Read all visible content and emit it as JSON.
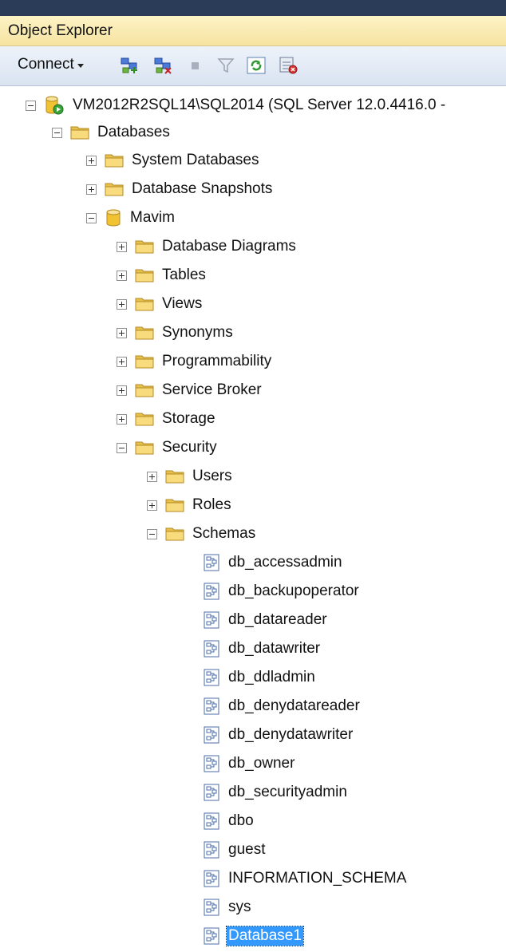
{
  "panel": {
    "title": "Object Explorer"
  },
  "toolbar": {
    "connect_label": "Connect",
    "icons": [
      "connect-object-explorer-icon",
      "disconnect-icon",
      "stop-icon",
      "filter-icon",
      "refresh-icon",
      "activity-monitor-icon"
    ]
  },
  "tree": {
    "server": "VM2012R2SQL14\\SQL2014 (SQL Server 12.0.4416.0 -",
    "databases": "Databases",
    "system_databases": "System Databases",
    "database_snapshots": "Database Snapshots",
    "mavim": "Mavim",
    "database_diagrams": "Database Diagrams",
    "tables": "Tables",
    "views": "Views",
    "synonyms": "Synonyms",
    "programmability": "Programmability",
    "service_broker": "Service Broker",
    "storage": "Storage",
    "security": "Security",
    "users": "Users",
    "roles": "Roles",
    "schemas": "Schemas",
    "schema_items": [
      "db_accessadmin",
      "db_backupoperator",
      "db_datareader",
      "db_datawriter",
      "db_ddladmin",
      "db_denydatareader",
      "db_denydatawriter",
      "db_owner",
      "db_securityadmin",
      "dbo",
      "guest",
      "INFORMATION_SCHEMA",
      "sys",
      "Database1"
    ],
    "selected": "Database1"
  },
  "colors": {
    "selection": "#3399ff",
    "folder": "#f3d26b",
    "database": "#f1c232"
  }
}
